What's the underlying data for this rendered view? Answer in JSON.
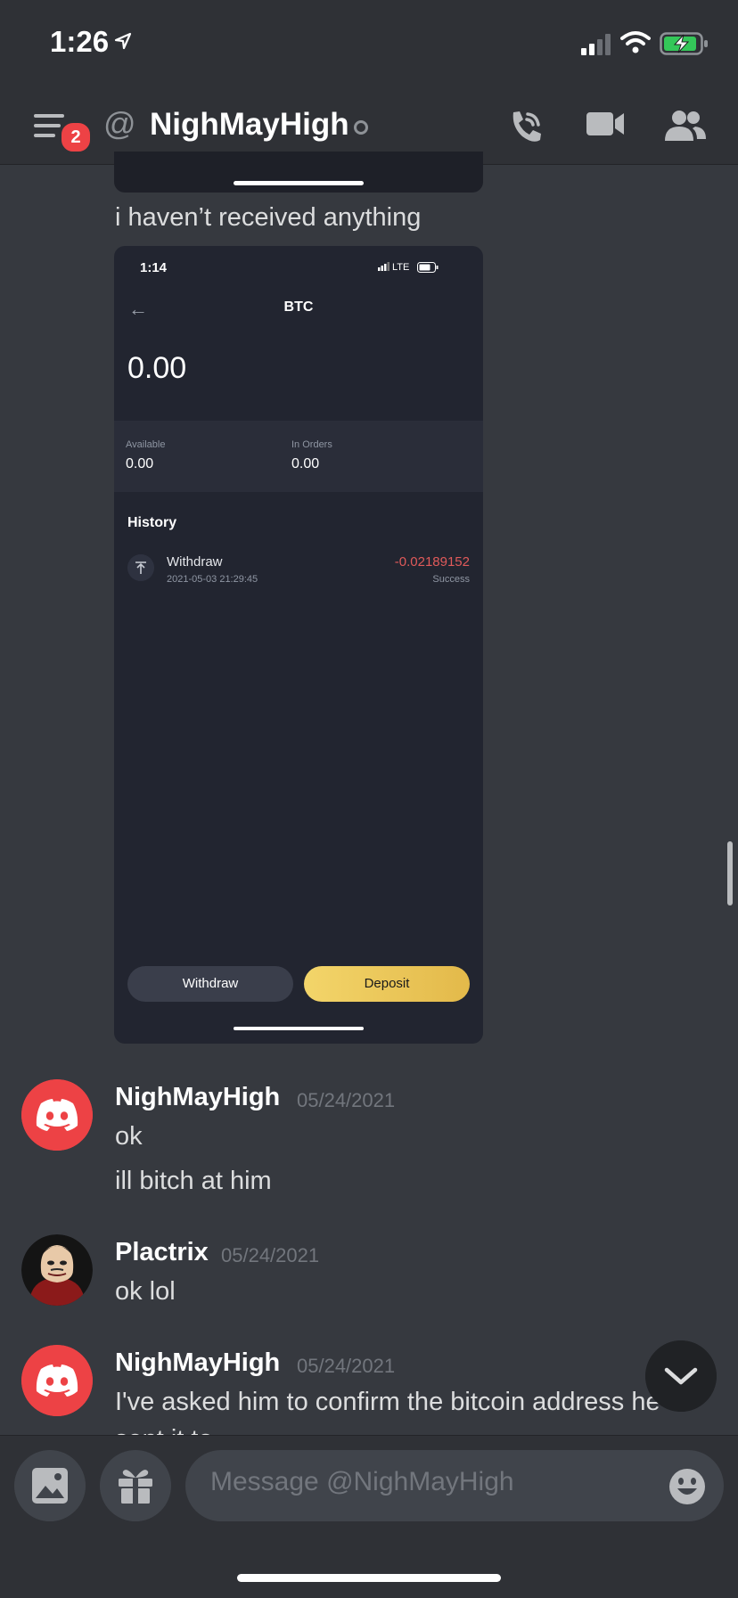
{
  "status_bar": {
    "time": "1:26"
  },
  "header": {
    "unread_badge": "2",
    "at_symbol": "@",
    "channel_name": "NighMayHigh"
  },
  "messages": {
    "top_text": "i haven’t received anything",
    "screenshot": {
      "time": "1:14",
      "network": "LTE",
      "title": "BTC",
      "balance": "0.00",
      "available_label": "Available",
      "available_value": "0.00",
      "in_orders_label": "In Orders",
      "in_orders_value": "0.00",
      "history_label": "History",
      "tx_name": "Withdraw",
      "tx_date": "2021-05-03 21:29:45",
      "tx_amount": "-0.02189152",
      "tx_status": "Success",
      "withdraw_button": "Withdraw",
      "deposit_button": "Deposit"
    },
    "groups": [
      {
        "author": "NighMayHigh",
        "timestamp": "05/24/2021",
        "lines": [
          "ok",
          "ill bitch at him"
        ]
      },
      {
        "author": "Plactrix",
        "timestamp": "05/24/2021",
        "lines": [
          "ok lol"
        ]
      },
      {
        "author": "NighMayHigh",
        "timestamp": "05/24/2021",
        "lines": [
          "I've asked him to confirm the bitcoin address he",
          "sent it to"
        ]
      }
    ]
  },
  "composer": {
    "placeholder": "Message @NighMayHigh"
  },
  "colors": {
    "accent_red": "#ed4245",
    "deposit_gold": "#e8c557",
    "negative_amount": "#e05a5a"
  }
}
